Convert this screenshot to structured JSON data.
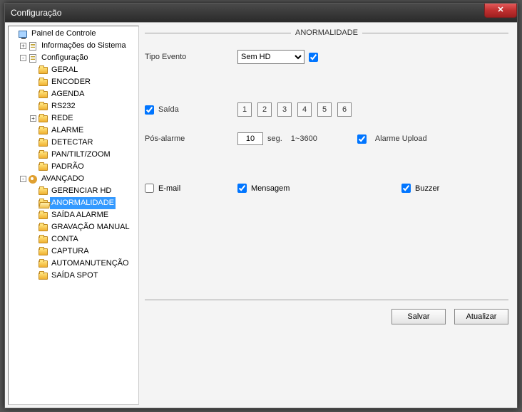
{
  "window": {
    "title": "Configuração",
    "close_glyph": "✕"
  },
  "tree": {
    "root": "Painel de Controle",
    "info": "Informações do Sistema",
    "config": {
      "label": "Configuração",
      "items": [
        "GERAL",
        "ENCODER",
        "AGENDA",
        "RS232",
        "REDE",
        "ALARME",
        "DETECTAR",
        "PAN/TILT/ZOOM",
        "PADRÃO"
      ]
    },
    "advanced": {
      "label": "AVANÇADO",
      "items": [
        "GERENCIAR HD",
        "ANORMALIDADE",
        "SAÍDA ALARME",
        "GRAVAÇÃO MANUAL",
        "CONTA",
        "CAPTURA",
        "AUTOMANUTENÇÃO",
        "SAÍDA SPOT"
      ]
    },
    "selected": "ANORMALIDADE",
    "rede_expandable": true
  },
  "main": {
    "section_title": "ANORMALIDADE",
    "tipo_evento_label": "Tipo Evento",
    "tipo_evento_value": "Sem HD",
    "tipo_evento_chk": true,
    "saida_label": "Saída",
    "saida_chk": true,
    "saida_channels": [
      "1",
      "2",
      "3",
      "4",
      "5",
      "6"
    ],
    "pos_alarme_label": "Pós-alarme",
    "pos_alarme_value": "10",
    "pos_alarme_unit": "seg.",
    "pos_alarme_range": "1~3600",
    "alarme_upload_label": "Alarme Upload",
    "alarme_upload_chk": true,
    "email_label": "E-mail",
    "email_chk": false,
    "mensagem_label": "Mensagem",
    "mensagem_chk": true,
    "buzzer_label": "Buzzer",
    "buzzer_chk": true,
    "salvar_label": "Salvar",
    "atualizar_label": "Atualizar"
  }
}
